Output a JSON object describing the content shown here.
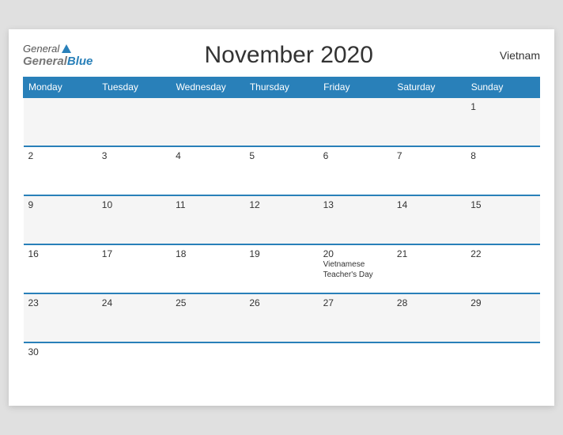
{
  "header": {
    "logo_general": "General",
    "logo_blue": "Blue",
    "title": "November 2020",
    "country": "Vietnam"
  },
  "days_of_week": [
    "Monday",
    "Tuesday",
    "Wednesday",
    "Thursday",
    "Friday",
    "Saturday",
    "Sunday"
  ],
  "weeks": [
    [
      {
        "num": "",
        "event": ""
      },
      {
        "num": "",
        "event": ""
      },
      {
        "num": "",
        "event": ""
      },
      {
        "num": "",
        "event": ""
      },
      {
        "num": "",
        "event": ""
      },
      {
        "num": "",
        "event": ""
      },
      {
        "num": "1",
        "event": ""
      }
    ],
    [
      {
        "num": "2",
        "event": ""
      },
      {
        "num": "3",
        "event": ""
      },
      {
        "num": "4",
        "event": ""
      },
      {
        "num": "5",
        "event": ""
      },
      {
        "num": "6",
        "event": ""
      },
      {
        "num": "7",
        "event": ""
      },
      {
        "num": "8",
        "event": ""
      }
    ],
    [
      {
        "num": "9",
        "event": ""
      },
      {
        "num": "10",
        "event": ""
      },
      {
        "num": "11",
        "event": ""
      },
      {
        "num": "12",
        "event": ""
      },
      {
        "num": "13",
        "event": ""
      },
      {
        "num": "14",
        "event": ""
      },
      {
        "num": "15",
        "event": ""
      }
    ],
    [
      {
        "num": "16",
        "event": ""
      },
      {
        "num": "17",
        "event": ""
      },
      {
        "num": "18",
        "event": ""
      },
      {
        "num": "19",
        "event": ""
      },
      {
        "num": "20",
        "event": "Vietnamese\nTeacher's Day"
      },
      {
        "num": "21",
        "event": ""
      },
      {
        "num": "22",
        "event": ""
      }
    ],
    [
      {
        "num": "23",
        "event": ""
      },
      {
        "num": "24",
        "event": ""
      },
      {
        "num": "25",
        "event": ""
      },
      {
        "num": "26",
        "event": ""
      },
      {
        "num": "27",
        "event": ""
      },
      {
        "num": "28",
        "event": ""
      },
      {
        "num": "29",
        "event": ""
      }
    ],
    [
      {
        "num": "30",
        "event": ""
      },
      {
        "num": "",
        "event": ""
      },
      {
        "num": "",
        "event": ""
      },
      {
        "num": "",
        "event": ""
      },
      {
        "num": "",
        "event": ""
      },
      {
        "num": "",
        "event": ""
      },
      {
        "num": "",
        "event": ""
      }
    ]
  ]
}
